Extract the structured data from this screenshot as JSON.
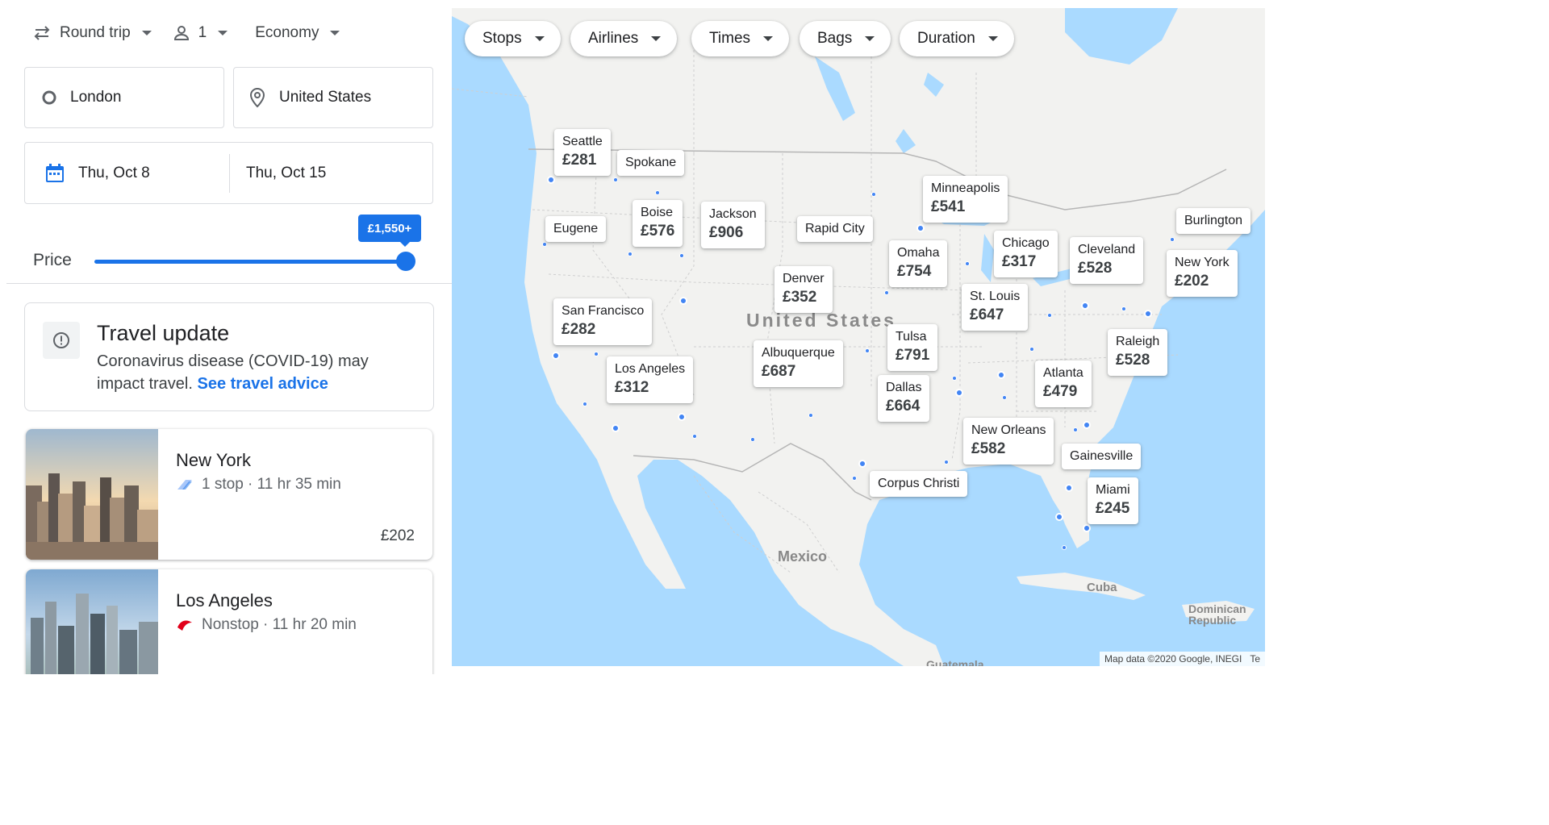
{
  "search": {
    "trip_type": "Round trip",
    "passengers": "1",
    "cabin": "Economy",
    "origin": "London",
    "destination": "United States",
    "depart_date": "Thu, Oct 8",
    "return_date": "Thu, Oct 15"
  },
  "price_filter": {
    "label": "Price",
    "max_label": "£1,550+",
    "level": 1.0
  },
  "travel_update": {
    "title": "Travel update",
    "body": "Coronavirus disease (COVID-19) may impact travel.",
    "link": "See travel advice"
  },
  "destinations": [
    {
      "name": "New York",
      "info": "1 stop · 11 hr 35 min",
      "price": "£202"
    },
    {
      "name": "Los Angeles",
      "info": "Nonstop · 11 hr 20 min",
      "price": ""
    }
  ],
  "filters": [
    "Stops",
    "Airlines",
    "Times",
    "Bags",
    "Duration"
  ],
  "map": {
    "country_label": "United States",
    "mexico": "Mexico",
    "cuba": "Cuba",
    "dominican": "Dominican Republic",
    "guatemala": "Guatemala",
    "attribution": "Map data ©2020 Google, INEGI",
    "attribution_cut": "Te",
    "pins": [
      {
        "city": "Seattle",
        "price": "£281"
      },
      {
        "city": "Spokane",
        "price": ""
      },
      {
        "city": "Eugene",
        "price": ""
      },
      {
        "city": "Boise",
        "price": "£576"
      },
      {
        "city": "Jackson",
        "price": "£906"
      },
      {
        "city": "Rapid City",
        "price": ""
      },
      {
        "city": "Minneapolis",
        "price": "£541"
      },
      {
        "city": "Burlington",
        "price": ""
      },
      {
        "city": "Omaha",
        "price": "£754"
      },
      {
        "city": "Chicago",
        "price": "£317"
      },
      {
        "city": "Cleveland",
        "price": "£528"
      },
      {
        "city": "New York",
        "price": "£202"
      },
      {
        "city": "Denver",
        "price": "£352"
      },
      {
        "city": "St. Louis",
        "price": "£647"
      },
      {
        "city": "San Francisco",
        "price": "£282"
      },
      {
        "city": "Tulsa",
        "price": "£791"
      },
      {
        "city": "Raleigh",
        "price": "£528"
      },
      {
        "city": "Albuquerque",
        "price": "£687"
      },
      {
        "city": "Los Angeles",
        "price": "£312"
      },
      {
        "city": "Atlanta",
        "price": "£479"
      },
      {
        "city": "Dallas",
        "price": "£664"
      },
      {
        "city": "New Orleans",
        "price": "£582"
      },
      {
        "city": "Gainesville",
        "price": ""
      },
      {
        "city": "Corpus Christi",
        "price": ""
      },
      {
        "city": "Miami",
        "price": "£245"
      }
    ]
  },
  "colors": {
    "accent": "#1a73e8",
    "dot": "#4285f4",
    "water": "#aadaff",
    "land": "#f5f5f5"
  },
  "icons": [
    "swap-icon",
    "person-icon",
    "circle-origin-icon",
    "location-pin-icon",
    "calendar-icon",
    "alert-icon",
    "airline-logo-icon"
  ]
}
